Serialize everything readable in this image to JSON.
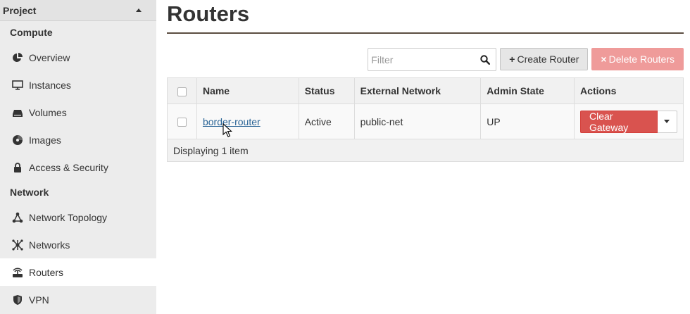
{
  "sidebar": {
    "project_label": "Project",
    "compute_label": "Compute",
    "network_label": "Network",
    "compute_items": [
      {
        "label": "Overview",
        "icon": "pie-chart-icon"
      },
      {
        "label": "Instances",
        "icon": "monitor-icon"
      },
      {
        "label": "Volumes",
        "icon": "hdd-icon"
      },
      {
        "label": "Images",
        "icon": "disc-icon"
      },
      {
        "label": "Access & Security",
        "icon": "lock-icon"
      }
    ],
    "network_items": [
      {
        "label": "Network Topology",
        "icon": "topology-icon"
      },
      {
        "label": "Networks",
        "icon": "network-icon"
      },
      {
        "label": "Routers",
        "icon": "router-icon",
        "active": true
      },
      {
        "label": "VPN",
        "icon": "shield-icon"
      }
    ]
  },
  "page": {
    "title": "Routers"
  },
  "toolbar": {
    "filter_placeholder": "Filter",
    "create_label": "Create Router",
    "delete_label": "Delete Routers"
  },
  "table": {
    "columns": [
      "Name",
      "Status",
      "External Network",
      "Admin State",
      "Actions"
    ],
    "rows": [
      {
        "name": "border-router",
        "status": "Active",
        "external_network": "public-net",
        "admin_state": "UP",
        "action_label": "Clear Gateway"
      }
    ],
    "footer": "Displaying 1 item"
  },
  "colors": {
    "danger": "#d9534f",
    "danger_disabled": "#ef9b9a",
    "sidebar_bg": "#ececec",
    "link": "#2a6496"
  }
}
